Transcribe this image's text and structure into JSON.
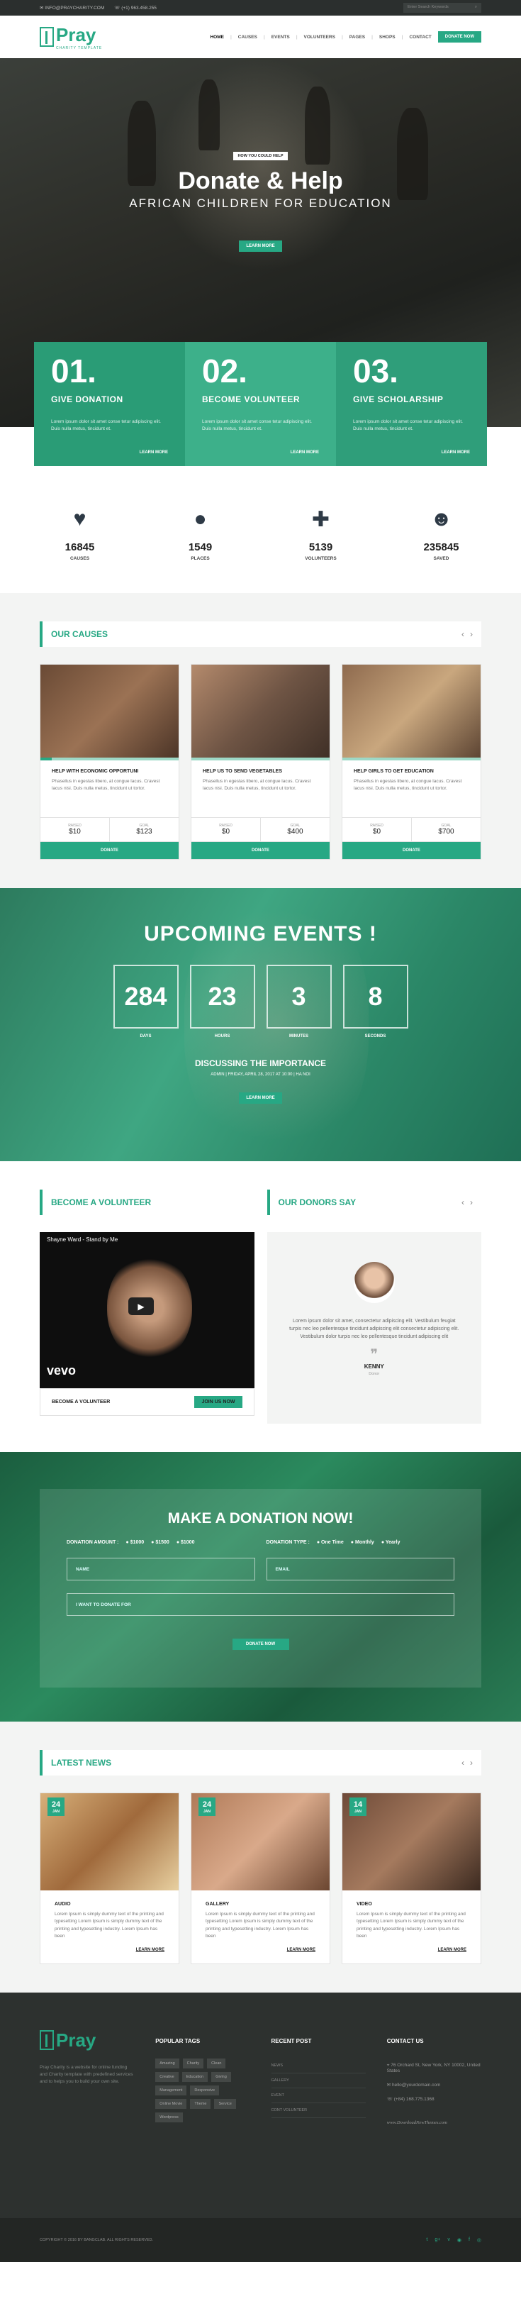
{
  "topbar": {
    "email": "INFO@PRAYCHARITY.COM",
    "phone": "(+1) 963.458.255",
    "search_placeholder": "Enter Search Keywords"
  },
  "logo": {
    "name": "Pray",
    "tagline": "CHARITY TEMPLATE"
  },
  "menu": [
    "HOME",
    "CAUSES",
    "EVENTS",
    "VOLUNTEERS",
    "PAGES",
    "SHOPS",
    "CONTACT"
  ],
  "donate_now": "DONATE NOW",
  "hero": {
    "tag": "HOW YOU COULD HELP",
    "title": "Donate & Help",
    "subtitle": "AFRICAN CHILDREN FOR EDUCATION",
    "button": "LEARN MORE"
  },
  "cards": [
    {
      "num": "01.",
      "title": "GIVE DONATION",
      "text": "Lorem ipsum dolor sit amet conse tetur adipiscing elit. Duis nulla metus, tincidunt et.",
      "link": "LEARN MORE"
    },
    {
      "num": "02.",
      "title": "BECOME VOLUNTEER",
      "text": "Lorem ipsum dolor sit amet conse tetur adipiscing elit. Duis nulla metus, tincidunt et.",
      "link": "LEARN MORE"
    },
    {
      "num": "03.",
      "title": "GIVE SCHOLARSHIP",
      "text": "Lorem ipsum dolor sit amet conse tetur adipiscing elit. Duis nulla metus, tincidunt et.",
      "link": "LEARN MORE"
    }
  ],
  "stats": [
    {
      "icon": "heartbeat-icon",
      "glyph": "♥",
      "value": "16845",
      "label": "CAUSES"
    },
    {
      "icon": "globe-icon",
      "glyph": "●",
      "value": "1549",
      "label": "PLACES"
    },
    {
      "icon": "user-plus-icon",
      "glyph": "✚",
      "value": "5139",
      "label": "VOLUNTEERS"
    },
    {
      "icon": "users-icon",
      "glyph": "☻",
      "value": "235845",
      "label": "SAVED"
    }
  ],
  "causes": {
    "title": "OUR CAUSES",
    "items": [
      {
        "title": "HELP WITH ECONOMIC OPPORTUNI",
        "text": "Phasellus in egestas libero, at congue lacus. Cravest lacus nisi. Duis nulla metus, tincidunt ut tortor.",
        "raised_label": "RAISED",
        "raised": "$10",
        "goal_label": "GOAL",
        "goal": "$123",
        "progress": 0.08,
        "button": "DONATE"
      },
      {
        "title": "HELP US TO SEND VEGETABLES",
        "text": "Phasellus in egestas libero, at congue lacus. Cravest lacus nisi. Duis nulla metus, tincidunt ut tortor.",
        "raised_label": "RAISED",
        "raised": "$0",
        "goal_label": "GOAL",
        "goal": "$400",
        "progress": 0,
        "button": "DONATE"
      },
      {
        "title": "HELP GIRLS TO GET EDUCATION",
        "text": "Phasellus in egestas libero, at congue lacus. Cravest lacus nisi. Duis nulla metus, tincidunt ut tortor.",
        "raised_label": "RAISED",
        "raised": "$0",
        "goal_label": "GOAL",
        "goal": "$700",
        "progress": 0,
        "button": "DONATE"
      }
    ]
  },
  "events": {
    "title": "UPCOMING EVENTS !",
    "counters": [
      {
        "v": "284",
        "l": "DAYS"
      },
      {
        "v": "23",
        "l": "HOURS"
      },
      {
        "v": "3",
        "l": "MINUTES"
      },
      {
        "v": "8",
        "l": "SECONDS"
      }
    ],
    "event_title": "DISCUSSING THE IMPORTANCE",
    "meta": "ADMIN   |   FRIDAY, APRIL 28, 2017 AT 10:00   |   HA NOI",
    "button": "LEARN MORE"
  },
  "volunteer": {
    "title": "BECOME A VOLUNTEER",
    "video_title": "Shayne Ward - Stand by Me",
    "vevo": "vevo",
    "label": "BECOME A VOLUNTEER",
    "button": "JOIN US NOW"
  },
  "donors": {
    "title": "OUR DONORS SAY",
    "text": "Lorem ipsum dolor sit amet, consectetur adipiscing elit. Vestibulum feugiat turpis nec leo pellentesque tincidunt adipiscing elit consectetur adipiscing elit. Vestibulum dolor turpis nec leo pellentesque tincidunt adipiscing elit",
    "name": "KENNY",
    "role": "Donor"
  },
  "donation": {
    "title": "MAKE A DONATION NOW!",
    "amount_label": "DONATION AMOUNT :",
    "amounts": [
      "$1000",
      "$1500",
      "$1000"
    ],
    "type_label": "DONATION TYPE :",
    "types": [
      "One Time",
      "Monthly",
      "Yearly"
    ],
    "name_ph": "NAME",
    "email_ph": "EMAIL",
    "want_ph": "I WANT TO DONATE FOR",
    "button": "DONATE NOW"
  },
  "news": {
    "title": "LATEST NEWS",
    "items": [
      {
        "day": "24",
        "mon": "JAN",
        "cat": "AUDIO",
        "text": "Lorem Ipsum is simply dummy text of the printing and typesetting Lorem Ipsum is simply dummy text of the printing and typesetting industry. Lorem Ipsum has been",
        "link": "LEARN MORE"
      },
      {
        "day": "24",
        "mon": "JAN",
        "cat": "GALLERY",
        "text": "Lorem Ipsum is simply dummy text of the printing and typesetting Lorem Ipsum is simply dummy text of the printing and typesetting industry. Lorem Ipsum has been",
        "link": "LEARN MORE"
      },
      {
        "day": "14",
        "mon": "JAN",
        "cat": "VIDEO",
        "text": "Lorem Ipsum is simply dummy text of the printing and typesetting Lorem Ipsum is simply dummy text of the printing and typesetting industry. Lorem Ipsum has been",
        "link": "LEARN MORE"
      }
    ]
  },
  "footer": {
    "about": "Pray Charity is a website for online funding and Charity template with predefined services and to helps you to build your own site.",
    "tags_title": "POPULAR TAGS",
    "tags": [
      "Amazing",
      "Charity",
      "Clean",
      "Creative",
      "Education",
      "Giving",
      "Management",
      "Responsive",
      "Online Movie",
      "Theme",
      "Service",
      "Wordpress"
    ],
    "posts_title": "RECENT POST",
    "posts": [
      "NEWS",
      "GALLERY",
      "EVENT",
      "CONT VOLUNTEER"
    ],
    "contact_title": "CONTACT US",
    "address": "76 Orchard St, New York, NY 10002, United States",
    "mail": "hello@yourdomain.com",
    "phone": "(+84) 168.775.1368",
    "watermark": "www.DownloadNewThemes.com"
  },
  "copyright": "COPYRIGHT © 2016 BY BANGCLAB. ALL RIGHTS RESERVED."
}
